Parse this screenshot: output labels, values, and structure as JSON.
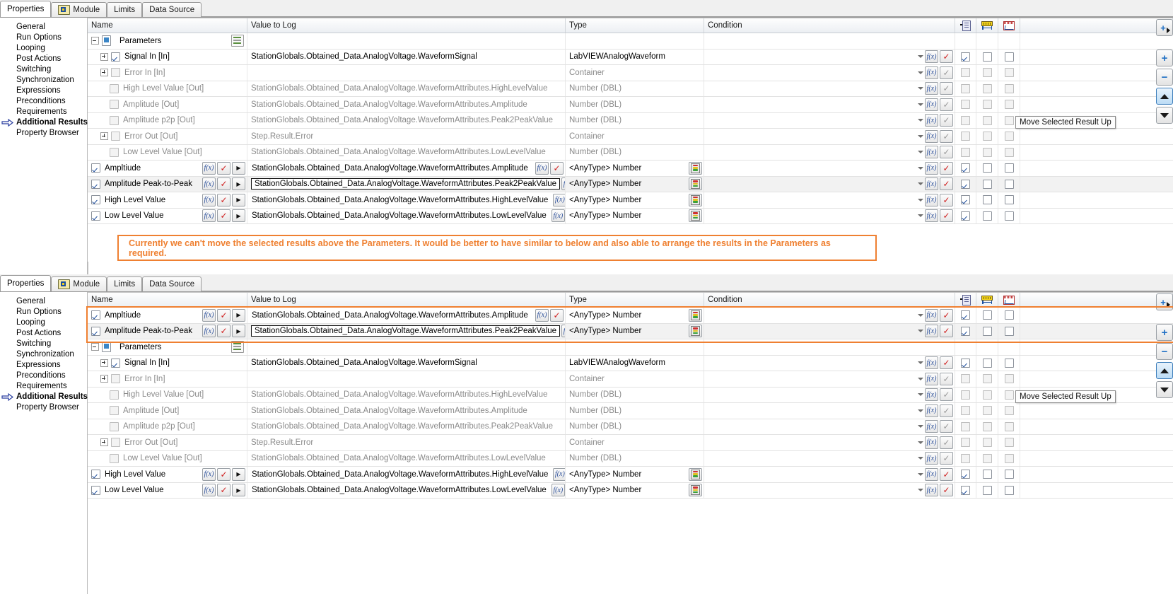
{
  "tabs": [
    {
      "id": "properties",
      "label": "Properties",
      "active": true,
      "icon": null
    },
    {
      "id": "module",
      "label": "Module",
      "active": false,
      "icon": "labview-module-icon"
    },
    {
      "id": "limits",
      "label": "Limits",
      "active": false,
      "icon": null
    },
    {
      "id": "datasource",
      "label": "Data Source",
      "active": false,
      "icon": null
    }
  ],
  "sidebar": {
    "items": [
      {
        "label": "General",
        "selected": false
      },
      {
        "label": "Run Options",
        "selected": false
      },
      {
        "label": "Looping",
        "selected": false
      },
      {
        "label": "Post Actions",
        "selected": false
      },
      {
        "label": "Switching",
        "selected": false
      },
      {
        "label": "Synchronization",
        "selected": false
      },
      {
        "label": "Expressions",
        "selected": false
      },
      {
        "label": "Preconditions",
        "selected": false
      },
      {
        "label": "Requirements",
        "selected": false
      },
      {
        "label": "Additional Results",
        "selected": true
      },
      {
        "label": "Property Browser",
        "selected": false
      }
    ]
  },
  "columns": {
    "name": "Name",
    "value_to_log": "Value to Log",
    "type": "Type",
    "condition": "Condition",
    "icon_cols": [
      "log-to-report-icon",
      "numeric-limit-icon",
      "waveform-icon"
    ]
  },
  "toolbar": {
    "add_label": "add-result-button",
    "plus_label": "+",
    "minus_label": "−",
    "move_up_label": "move-up-button",
    "move_down_label": "move-down-button"
  },
  "tooltip": {
    "text": "Move Selected Result Up"
  },
  "annotation": {
    "text": "Currently we can't move the selected results above the Parameters. It would be better to have similar to below and also able to arrange the results in the Parameters as required.",
    "color": "#ef8031"
  },
  "top_panel": {
    "rows": [
      {
        "kind": "group",
        "indent": 0,
        "twisty": "minus",
        "box": "square",
        "name": "Parameters",
        "value": "",
        "type": "",
        "checked": null,
        "editable": false,
        "minilist": true
      },
      {
        "kind": "param",
        "indent": 1,
        "twisty": "plus",
        "name": "Signal In [In]",
        "value": "StationGlobals.Obtained_Data.AnalogVoltage.WaveformSignal",
        "type": "LabVIEWAnalogWaveform",
        "checked": true,
        "dim": false,
        "k1": true,
        "k2": false,
        "k3": false,
        "active": true
      },
      {
        "kind": "param",
        "indent": 1,
        "twisty": "plus",
        "name": "Error In [In]",
        "value": "",
        "type": "Container",
        "checked": false,
        "dim": true,
        "k1": false,
        "k2": false,
        "k3": false,
        "active": false
      },
      {
        "kind": "param",
        "indent": 1,
        "twisty": "dots",
        "name": "High Level Value [Out]",
        "value": "StationGlobals.Obtained_Data.AnalogVoltage.WaveformAttributes.HighLevelValue",
        "type": "Number (DBL)",
        "checked": false,
        "dim": true,
        "k1": false,
        "k2": false,
        "k3": false,
        "active": false
      },
      {
        "kind": "param",
        "indent": 1,
        "twisty": "dots",
        "name": "Amplitude [Out]",
        "value": "StationGlobals.Obtained_Data.AnalogVoltage.WaveformAttributes.Amplitude",
        "type": "Number (DBL)",
        "checked": false,
        "dim": true,
        "k1": false,
        "k2": false,
        "k3": false,
        "active": false
      },
      {
        "kind": "param",
        "indent": 1,
        "twisty": "dots",
        "name": "Amplitude p2p [Out]",
        "value": "StationGlobals.Obtained_Data.AnalogVoltage.WaveformAttributes.Peak2PeakValue",
        "type": "Number (DBL)",
        "checked": false,
        "dim": true,
        "k1": false,
        "k2": false,
        "k3": false,
        "active": false
      },
      {
        "kind": "param",
        "indent": 1,
        "twisty": "plus",
        "name": "Error Out [Out]",
        "value": "Step.Result.Error",
        "type": "Container",
        "checked": false,
        "dim": true,
        "k1": false,
        "k2": false,
        "k3": false,
        "active": false
      },
      {
        "kind": "param",
        "indent": 1,
        "twisty": "dots",
        "name": "Low Level Value [Out]",
        "value": "StationGlobals.Obtained_Data.AnalogVoltage.WaveformAttributes.LowLevelValue",
        "type": "Number (DBL)",
        "checked": false,
        "dim": true,
        "k1": false,
        "k2": false,
        "k3": false,
        "active": false
      },
      {
        "kind": "result",
        "indent": 0,
        "name": "Ampltiude",
        "value": "StationGlobals.Obtained_Data.AnalogVoltage.WaveformAttributes.Amplitude",
        "type": "<AnyType> Number",
        "checked": true,
        "editing": false,
        "k1": true,
        "k2": false,
        "k3": false,
        "active": true
      },
      {
        "kind": "result",
        "indent": 0,
        "name": "Amplitude Peak-to-Peak",
        "value": "StationGlobals.Obtained_Data.AnalogVoltage.WaveformAttributes.Peak2PeakValue",
        "type": "<AnyType> Number",
        "checked": true,
        "editing": true,
        "selected": true,
        "k1": true,
        "k2": false,
        "k3": false,
        "active": true
      },
      {
        "kind": "result",
        "indent": 0,
        "name": "High Level Value",
        "value": "StationGlobals.Obtained_Data.AnalogVoltage.WaveformAttributes.HighLevelValue",
        "type": "<AnyType> Number",
        "checked": true,
        "editing": false,
        "k1": true,
        "k2": false,
        "k3": false,
        "active": true
      },
      {
        "kind": "result",
        "indent": 0,
        "name": "Low Level Value",
        "value": "StationGlobals.Obtained_Data.AnalogVoltage.WaveformAttributes.LowLevelValue",
        "type": "<AnyType> Number",
        "checked": true,
        "editing": false,
        "k1": true,
        "k2": false,
        "k3": false,
        "active": true
      }
    ]
  },
  "bottom_panel": {
    "rows": [
      {
        "kind": "result",
        "indent": 0,
        "name": "Ampltiude",
        "value": "StationGlobals.Obtained_Data.AnalogVoltage.WaveformAttributes.Amplitude",
        "type": "<AnyType> Number",
        "checked": true,
        "editing": false,
        "k1": true,
        "k2": false,
        "k3": false,
        "active": true,
        "highlight": true
      },
      {
        "kind": "result",
        "indent": 0,
        "name": "Amplitude Peak-to-Peak",
        "value": "StationGlobals.Obtained_Data.AnalogVoltage.WaveformAttributes.Peak2PeakValue",
        "type": "<AnyType> Number",
        "checked": true,
        "editing": true,
        "selected": true,
        "k1": true,
        "k2": false,
        "k3": false,
        "active": true,
        "highlight": true
      },
      {
        "kind": "group",
        "indent": 0,
        "twisty": "minus",
        "box": "square",
        "name": "Parameters",
        "value": "",
        "type": "",
        "checked": null,
        "editable": false,
        "minilist": true
      },
      {
        "kind": "param",
        "indent": 1,
        "twisty": "plus",
        "name": "Signal In [In]",
        "value": "StationGlobals.Obtained_Data.AnalogVoltage.WaveformSignal",
        "type": "LabVIEWAnalogWaveform",
        "checked": true,
        "dim": false,
        "k1": true,
        "k2": false,
        "k3": false,
        "active": true
      },
      {
        "kind": "param",
        "indent": 1,
        "twisty": "plus",
        "name": "Error In [In]",
        "value": "",
        "type": "Container",
        "checked": false,
        "dim": true,
        "k1": false,
        "k2": false,
        "k3": false,
        "active": false
      },
      {
        "kind": "param",
        "indent": 1,
        "twisty": "dots",
        "name": "High Level Value [Out]",
        "value": "StationGlobals.Obtained_Data.AnalogVoltage.WaveformAttributes.HighLevelValue",
        "type": "Number (DBL)",
        "checked": false,
        "dim": true,
        "k1": false,
        "k2": false,
        "k3": false,
        "active": false
      },
      {
        "kind": "param",
        "indent": 1,
        "twisty": "dots",
        "name": "Amplitude [Out]",
        "value": "StationGlobals.Obtained_Data.AnalogVoltage.WaveformAttributes.Amplitude",
        "type": "Number (DBL)",
        "checked": false,
        "dim": true,
        "k1": false,
        "k2": false,
        "k3": false,
        "active": false
      },
      {
        "kind": "param",
        "indent": 1,
        "twisty": "dots",
        "name": "Amplitude p2p [Out]",
        "value": "StationGlobals.Obtained_Data.AnalogVoltage.WaveformAttributes.Peak2PeakValue",
        "type": "Number (DBL)",
        "checked": false,
        "dim": true,
        "k1": false,
        "k2": false,
        "k3": false,
        "active": false
      },
      {
        "kind": "param",
        "indent": 1,
        "twisty": "plus",
        "name": "Error Out [Out]",
        "value": "Step.Result.Error",
        "type": "Container",
        "checked": false,
        "dim": true,
        "k1": false,
        "k2": false,
        "k3": false,
        "active": false
      },
      {
        "kind": "param",
        "indent": 1,
        "twisty": "dots",
        "name": "Low Level Value [Out]",
        "value": "StationGlobals.Obtained_Data.AnalogVoltage.WaveformAttributes.LowLevelValue",
        "type": "Number (DBL)",
        "checked": false,
        "dim": true,
        "k1": false,
        "k2": false,
        "k3": false,
        "active": false
      },
      {
        "kind": "result",
        "indent": 0,
        "name": "High Level Value",
        "value": "StationGlobals.Obtained_Data.AnalogVoltage.WaveformAttributes.HighLevelValue",
        "type": "<AnyType> Number",
        "checked": true,
        "editing": false,
        "k1": true,
        "k2": false,
        "k3": false,
        "active": true
      },
      {
        "kind": "result",
        "indent": 0,
        "name": "Low Level Value",
        "value": "StationGlobals.Obtained_Data.AnalogVoltage.WaveformAttributes.LowLevelValue",
        "type": "<AnyType> Number",
        "checked": true,
        "editing": false,
        "k1": true,
        "k2": false,
        "k3": false,
        "active": true
      }
    ]
  }
}
